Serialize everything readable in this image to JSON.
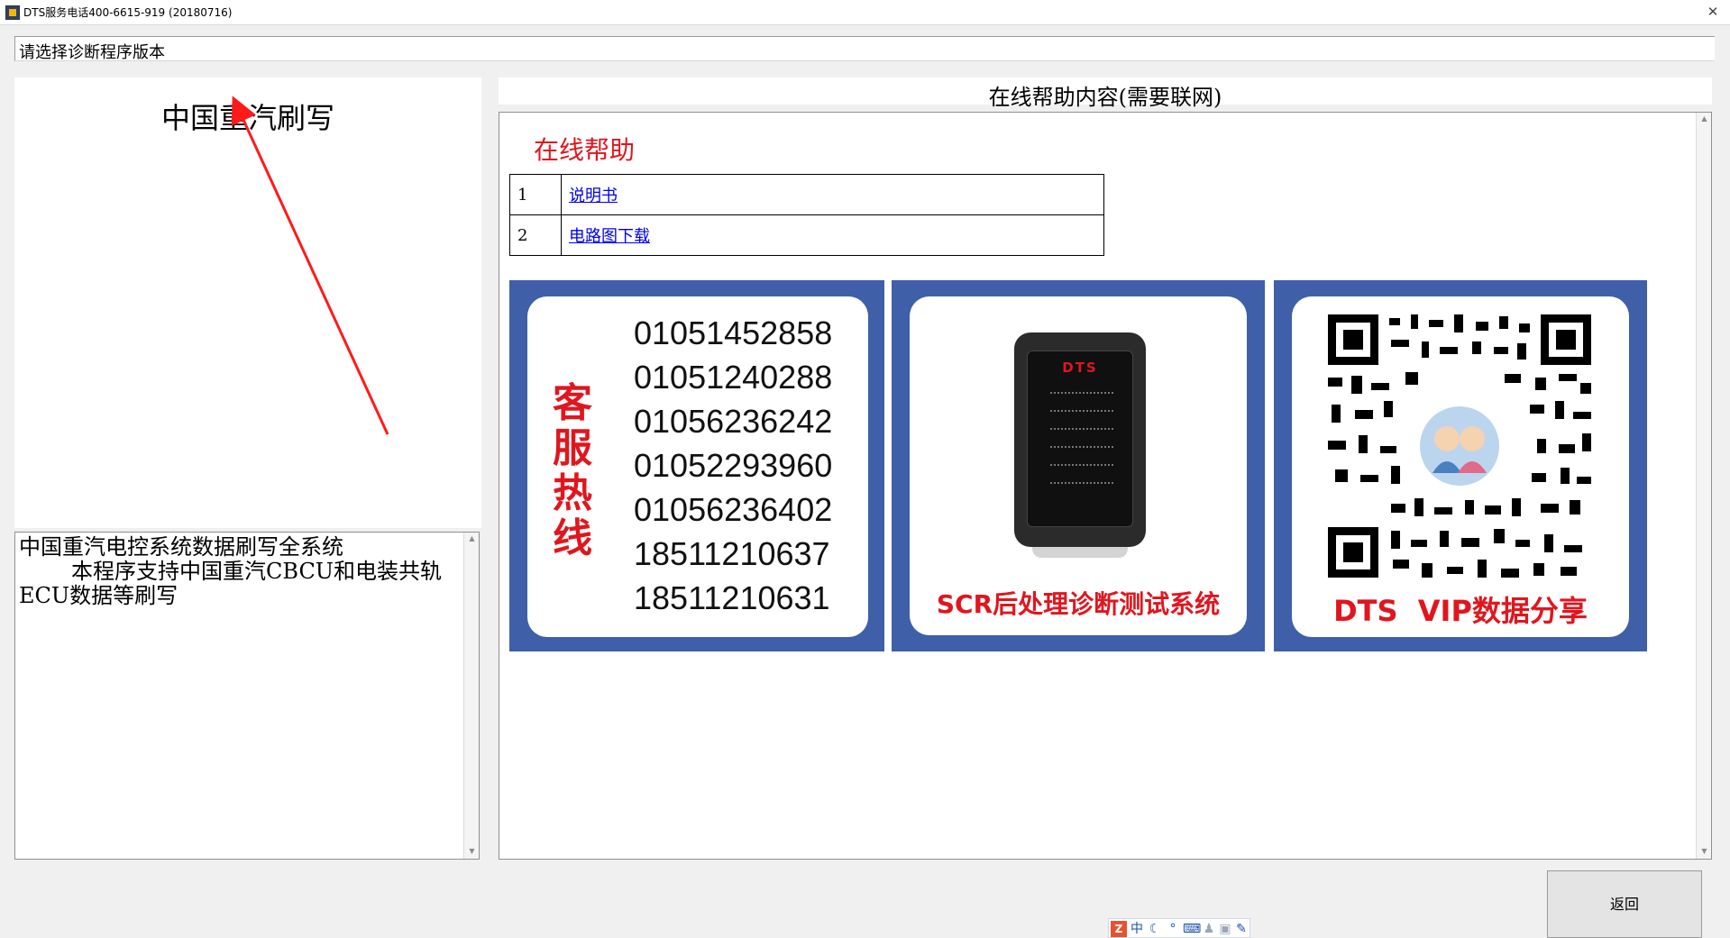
{
  "window": {
    "title": "DTS服务电话400-6615-919 (20180716)",
    "close_glyph": "✕"
  },
  "version_bar": {
    "label": "请选择诊断程序版本"
  },
  "program_panel": {
    "selected_program": "中国重汽刷写"
  },
  "description": {
    "line1": "中国重汽电控系统数据刷写全系统",
    "line2": "本程序支持中国重汽CBCU和电装共轨ECU数据等刷写"
  },
  "help": {
    "header": "在线帮助内容(需要联网)",
    "heading": "在线帮助",
    "rows": [
      {
        "num": "1",
        "link": "说明书"
      },
      {
        "num": "2",
        "link": "电路图下载"
      }
    ]
  },
  "banners": {
    "hotline": {
      "chars": [
        "客",
        "服",
        "热",
        "线"
      ],
      "phones": [
        "01051452858",
        "01051240288",
        "01056236242",
        "01052293960",
        "01056236402",
        "18511210637",
        "18511210631"
      ]
    },
    "device": {
      "brand": "DTS",
      "caption": "SCR后处理诊断测试系统"
    },
    "qr": {
      "caption": "DTS  VIP数据分享"
    }
  },
  "buttons": {
    "back": "返回"
  },
  "ime": {
    "mode": "中"
  },
  "colors": {
    "accent_red": "#e0161e",
    "banner_blue": "#3f5fa8",
    "link_blue": "#0000ee"
  }
}
